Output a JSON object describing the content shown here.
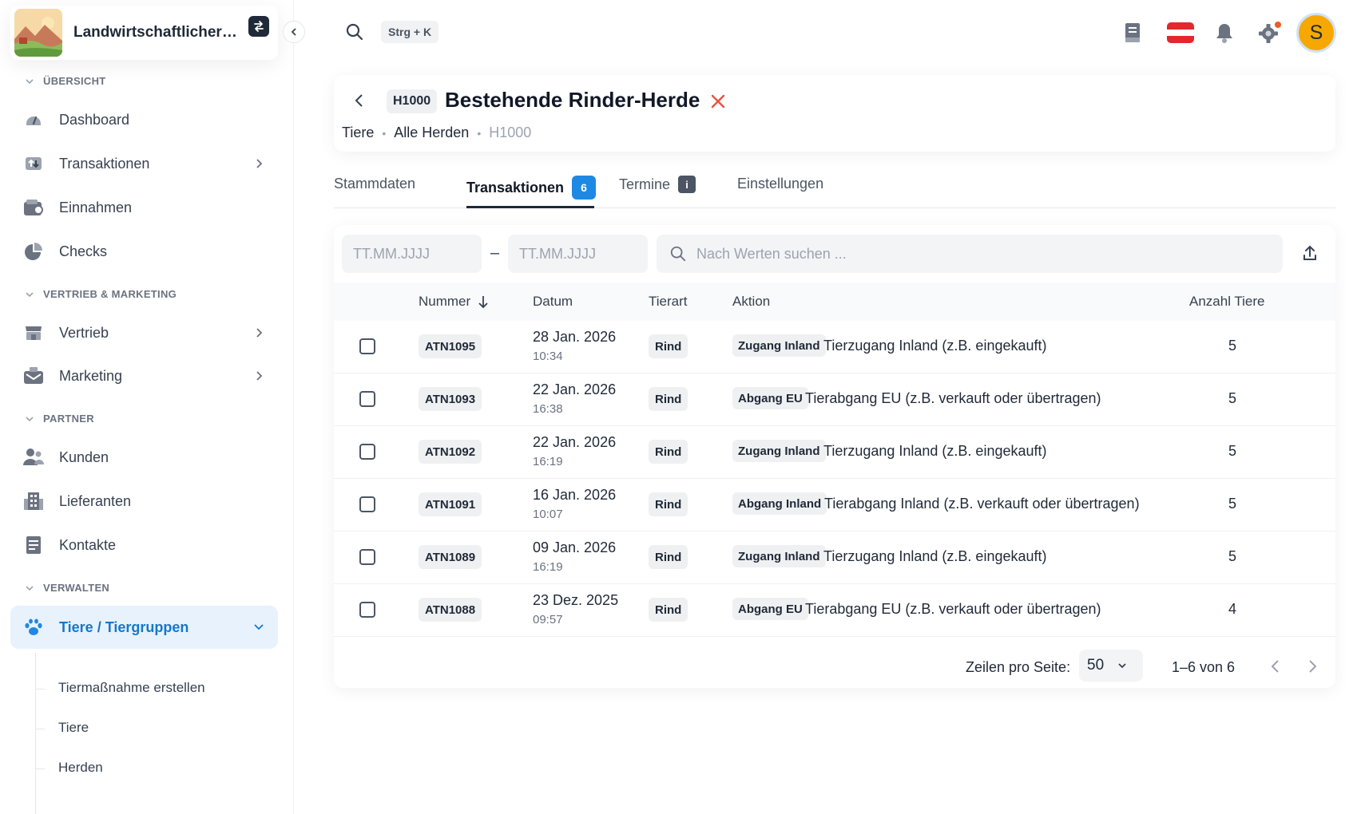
{
  "app": {
    "org_name": "Landwirtschaftlicher B...",
    "search_shortcut": "Strg + K"
  },
  "sidebar": {
    "sections": [
      {
        "title": "ÜBERSICHT"
      },
      {
        "title": "VERTRIEB & MARKETING"
      },
      {
        "title": "PARTNER"
      },
      {
        "title": "VERWALTEN"
      }
    ],
    "items": [
      {
        "label": "Dashboard",
        "icon": "dashboard-icon"
      },
      {
        "label": "Transaktionen",
        "icon": "transactions-icon"
      },
      {
        "label": "Einnahmen",
        "icon": "wallet-icon"
      },
      {
        "label": "Checks",
        "icon": "pie-chart-icon"
      },
      {
        "label": "Vertrieb",
        "icon": "store-icon"
      },
      {
        "label": "Marketing",
        "icon": "mailbox-icon"
      },
      {
        "label": "Kunden",
        "icon": "users-icon"
      },
      {
        "label": "Lieferanten",
        "icon": "building-icon"
      },
      {
        "label": "Kontakte",
        "icon": "contacts-icon"
      },
      {
        "label": "Tiere / Tiergruppen",
        "icon": "paw-icon"
      }
    ],
    "sub_items": [
      {
        "label": "Tiermaßnahme erstellen"
      },
      {
        "label": "Tiere"
      },
      {
        "label": "Herden"
      }
    ]
  },
  "header": {
    "id": "H1000",
    "title": "Bestehende Rinder-Herde",
    "breadcrumb": [
      "Tiere",
      "Alle Herden",
      "H1000"
    ]
  },
  "tabs": [
    {
      "label": "Stammdaten"
    },
    {
      "label": "Transaktionen",
      "badge": "6"
    },
    {
      "label": "Termine",
      "badge": "i"
    },
    {
      "label": "Einstellungen"
    }
  ],
  "filters": {
    "date_from_placeholder": "TT.MM.JJJJ",
    "date_to_placeholder": "TT.MM.JJJJ",
    "separator": "–",
    "search_placeholder": "Nach Werten suchen ..."
  },
  "table": {
    "columns": [
      "Nummer",
      "Datum",
      "Tierart",
      "Aktion",
      "Anzahl Tiere"
    ],
    "rows": [
      {
        "nummer": "ATN1095",
        "datum": "28 Jan. 2026",
        "zeit": "10:34",
        "tierart": "Rind",
        "aktion_chip": "Zugang Inland",
        "aktion_text": "Tierzugang Inland (z.B. eingekauft)",
        "anzahl": "5"
      },
      {
        "nummer": "ATN1093",
        "datum": "22 Jan. 2026",
        "zeit": "16:38",
        "tierart": "Rind",
        "aktion_chip": "Abgang EU",
        "aktion_text": "Tierabgang EU (z.B. verkauft oder übertragen)",
        "anzahl": "5"
      },
      {
        "nummer": "ATN1092",
        "datum": "22 Jan. 2026",
        "zeit": "16:19",
        "tierart": "Rind",
        "aktion_chip": "Zugang Inland",
        "aktion_text": "Tierzugang Inland (z.B. eingekauft)",
        "anzahl": "5"
      },
      {
        "nummer": "ATN1091",
        "datum": "16 Jan. 2026",
        "zeit": "10:07",
        "tierart": "Rind",
        "aktion_chip": "Abgang Inland",
        "aktion_text": "Tierabgang Inland (z.B. verkauft oder übertragen)",
        "anzahl": "5"
      },
      {
        "nummer": "ATN1089",
        "datum": "09 Jan. 2026",
        "zeit": "16:19",
        "tierart": "Rind",
        "aktion_chip": "Zugang Inland",
        "aktion_text": "Tierzugang Inland (z.B. eingekauft)",
        "anzahl": "5"
      },
      {
        "nummer": "ATN1088",
        "datum": "23 Dez. 2025",
        "zeit": "09:57",
        "tierart": "Rind",
        "aktion_chip": "Abgang EU",
        "aktion_text": "Tierabgang EU (z.B. verkauft oder übertragen)",
        "anzahl": "4"
      }
    ]
  },
  "pagination": {
    "rows_per_page_label": "Zeilen pro Seite:",
    "rows_per_page": "50",
    "range": "1–6 von 6"
  },
  "user": {
    "initial": "S"
  },
  "colors": {
    "accent": "#1e88e5",
    "active_nav_bg": "#e8f2fc",
    "active_nav_text": "#1677c9",
    "avatar": "#f6a800",
    "close": "#e5533d",
    "notification_dot": "#f05a28"
  }
}
